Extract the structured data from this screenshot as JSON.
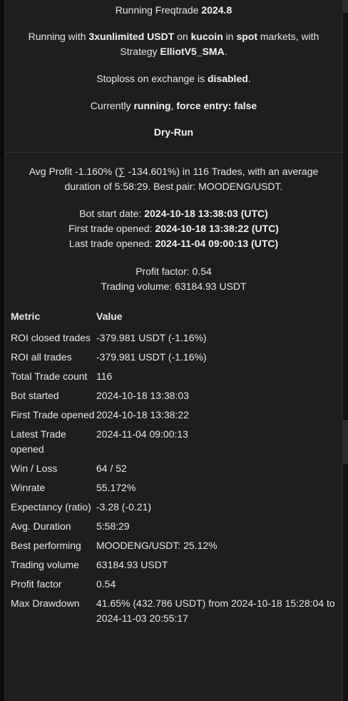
{
  "header": {
    "running_prefix": "Running Freqtrade ",
    "version": "2024.8",
    "line2": {
      "p1": "Running with ",
      "stake": "3xunlimited USDT",
      "p2": " on ",
      "exchange": "kucoin",
      "p3": " in ",
      "market": "spot",
      "p4": " markets, with"
    },
    "line3": {
      "p1": "Strategy ",
      "strategy": "ElliotV5_SMA",
      "p2": "."
    },
    "stoploss": {
      "p1": "Stoploss on exchange is ",
      "value": "disabled",
      "p2": "."
    },
    "state": {
      "p1": "Currently ",
      "value": "running",
      "p2": ", ",
      "force": "force entry: false"
    },
    "mode": "Dry-Run"
  },
  "summary": {
    "avg_line1": "Avg Profit -1.160% (∑ -134.601%) in 116 Trades, with an average",
    "avg_line2": "duration of 5:58:29. Best pair: MOODENG/USDT.",
    "bot_start_label": "Bot start date: ",
    "bot_start_value": "2024-10-18 13:38:03 (UTC)",
    "first_trade_label": "First trade opened: ",
    "first_trade_value": "2024-10-18 13:38:22 (UTC)",
    "last_trade_label": "Last trade opened: ",
    "last_trade_value": "2024-11-04 09:00:13 (UTC)",
    "profit_factor": "Profit factor: 0.54",
    "trading_volume": "Trading volume: 63184.93 USDT"
  },
  "table": {
    "col_metric": "Metric",
    "col_value": "Value",
    "rows": [
      {
        "metric": "ROI closed trades",
        "value": "-379.981 USDT (-1.16%)"
      },
      {
        "metric": "ROI all trades",
        "value": "-379.981 USDT (-1.16%)"
      },
      {
        "metric": "Total Trade count",
        "value": "116"
      },
      {
        "metric": "Bot started",
        "value": "2024-10-18 13:38:03"
      },
      {
        "metric": "First Trade opened",
        "value": "2024-10-18 13:38:22"
      },
      {
        "metric": "Latest Trade opened",
        "value": "2024-11-04 09:00:13"
      },
      {
        "metric": "Win / Loss",
        "value": "64 / 52"
      },
      {
        "metric": "Winrate",
        "value": "55.172%"
      },
      {
        "metric": "Expectancy (ratio)",
        "value": "-3.28 (-0.21)"
      },
      {
        "metric": "Avg. Duration",
        "value": "5:58:29"
      },
      {
        "metric": "Best performing",
        "value": "MOODENG/USDT: 25.12%"
      },
      {
        "metric": "Trading volume",
        "value": "63184.93 USDT"
      },
      {
        "metric": "Profit factor",
        "value": "0.54"
      },
      {
        "metric": "Max Drawdown",
        "value": "41.65% (432.786 USDT) from 2024-10-18 15:28:04 to 2024-11-03 20:55:17"
      }
    ]
  }
}
